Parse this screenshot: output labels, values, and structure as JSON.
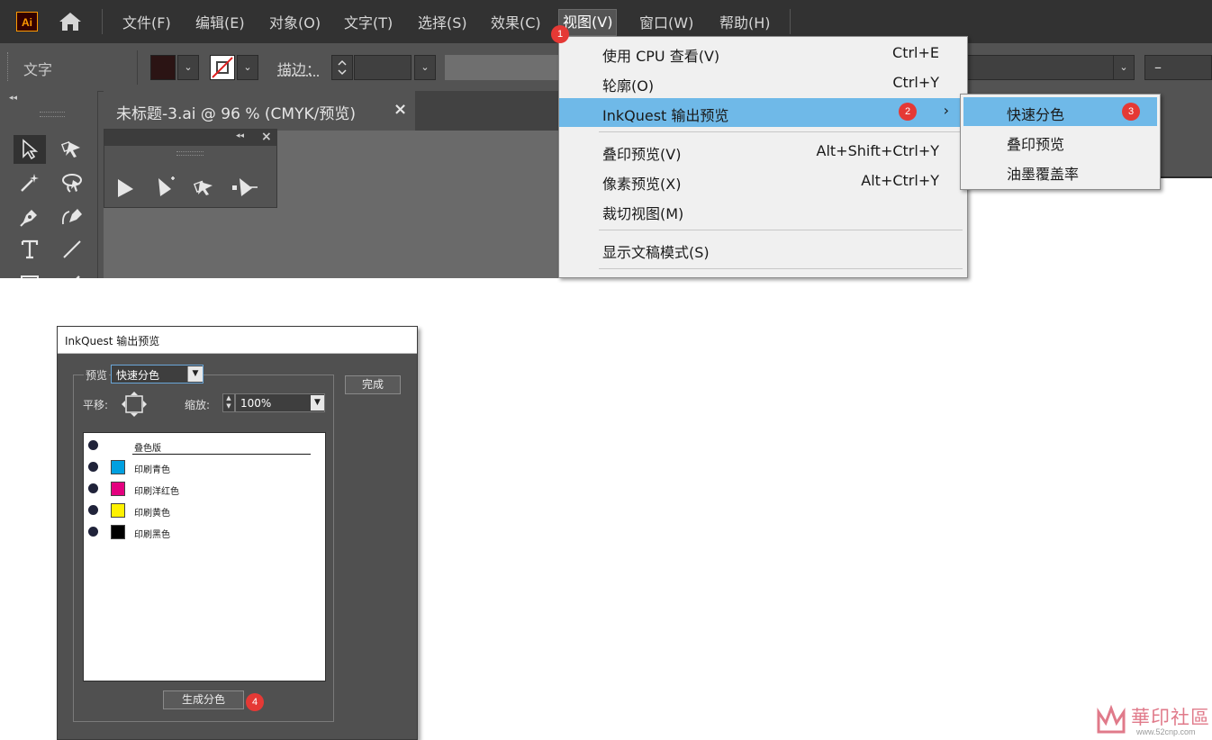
{
  "menubar": {
    "logo": "Ai",
    "items": [
      "文件(F)",
      "编辑(E)",
      "对象(O)",
      "文字(T)",
      "选择(S)",
      "效果(C)",
      "视图(V)",
      "窗口(W)",
      "帮助(H)"
    ]
  },
  "controlbar": {
    "type_label": "文字",
    "stroke_label": "描边：",
    "right_field_value": "–"
  },
  "document": {
    "tab_title": "未标题-3.ai @ 96 % (CMYK/预览)",
    "close_glyph": "×"
  },
  "view_menu": {
    "items": [
      {
        "label": "使用 CPU 查看(V)",
        "shortcut": "Ctrl+E"
      },
      {
        "label": "轮廓(O)",
        "shortcut": "Ctrl+Y"
      },
      {
        "label": "InkQuest 输出预览",
        "shortcut": ""
      },
      {
        "label": "叠印预览(V)",
        "shortcut": "Alt+Shift+Ctrl+Y"
      },
      {
        "label": "像素预览(X)",
        "shortcut": "Alt+Ctrl+Y"
      },
      {
        "label": "裁切视图(M)",
        "shortcut": ""
      },
      {
        "label": "显示文稿模式(S)",
        "shortcut": ""
      }
    ],
    "submenu_arrow": "›"
  },
  "sub_menu": {
    "items": [
      "快速分色",
      "叠印预览",
      "油墨覆盖率"
    ]
  },
  "badges": [
    "1",
    "2",
    "3",
    "4"
  ],
  "dialog": {
    "title": "InkQuest 输出预览",
    "preview_label": "预览",
    "preview_value": "快速分色",
    "done_label": "完成",
    "pan_label": "平移:",
    "zoom_label": "缩放:",
    "zoom_value": "100%",
    "separations": [
      {
        "name": "叠色版",
        "color": ""
      },
      {
        "name": "印刷青色",
        "color": "#00a0e0"
      },
      {
        "name": "印刷洋红色",
        "color": "#e4007f"
      },
      {
        "name": "印刷黄色",
        "color": "#fff100"
      },
      {
        "name": "印刷黑色",
        "color": "#000000"
      }
    ],
    "generate_label": "生成分色"
  },
  "watermark": {
    "text": "華印社區",
    "url": "www.52cnp.com"
  },
  "colors": {
    "menu_highlight": "#6fb9e8",
    "badge": "#e53935",
    "app_bg": "#535353",
    "menubar_bg": "#323232"
  }
}
